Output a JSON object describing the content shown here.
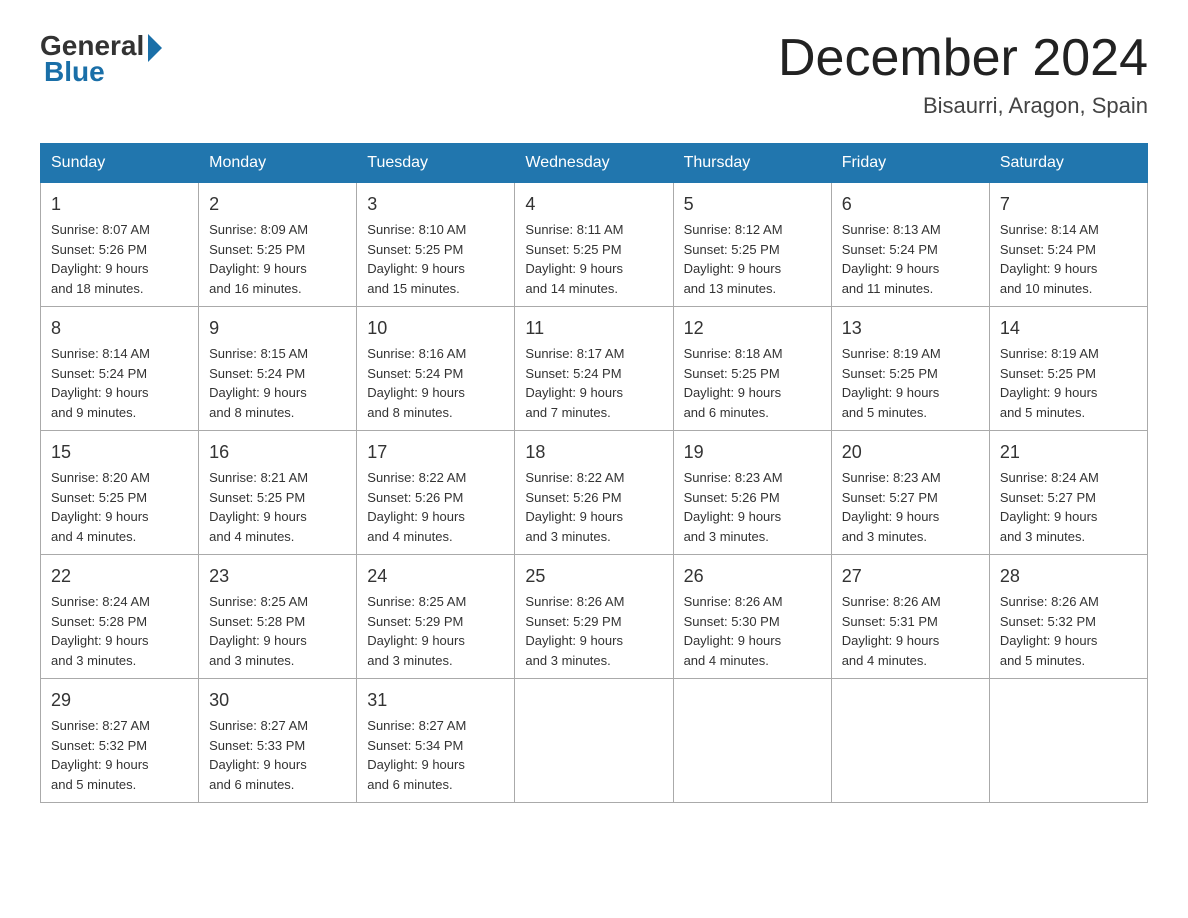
{
  "header": {
    "logo_general": "General",
    "logo_blue": "Blue",
    "main_title": "December 2024",
    "subtitle": "Bisaurri, Aragon, Spain"
  },
  "days_of_week": [
    "Sunday",
    "Monday",
    "Tuesday",
    "Wednesday",
    "Thursday",
    "Friday",
    "Saturday"
  ],
  "weeks": [
    [
      {
        "day": "1",
        "sunrise": "8:07 AM",
        "sunset": "5:26 PM",
        "daylight": "9 hours and 18 minutes."
      },
      {
        "day": "2",
        "sunrise": "8:09 AM",
        "sunset": "5:25 PM",
        "daylight": "9 hours and 16 minutes."
      },
      {
        "day": "3",
        "sunrise": "8:10 AM",
        "sunset": "5:25 PM",
        "daylight": "9 hours and 15 minutes."
      },
      {
        "day": "4",
        "sunrise": "8:11 AM",
        "sunset": "5:25 PM",
        "daylight": "9 hours and 14 minutes."
      },
      {
        "day": "5",
        "sunrise": "8:12 AM",
        "sunset": "5:25 PM",
        "daylight": "9 hours and 13 minutes."
      },
      {
        "day": "6",
        "sunrise": "8:13 AM",
        "sunset": "5:24 PM",
        "daylight": "9 hours and 11 minutes."
      },
      {
        "day": "7",
        "sunrise": "8:14 AM",
        "sunset": "5:24 PM",
        "daylight": "9 hours and 10 minutes."
      }
    ],
    [
      {
        "day": "8",
        "sunrise": "8:14 AM",
        "sunset": "5:24 PM",
        "daylight": "9 hours and 9 minutes."
      },
      {
        "day": "9",
        "sunrise": "8:15 AM",
        "sunset": "5:24 PM",
        "daylight": "9 hours and 8 minutes."
      },
      {
        "day": "10",
        "sunrise": "8:16 AM",
        "sunset": "5:24 PM",
        "daylight": "9 hours and 8 minutes."
      },
      {
        "day": "11",
        "sunrise": "8:17 AM",
        "sunset": "5:24 PM",
        "daylight": "9 hours and 7 minutes."
      },
      {
        "day": "12",
        "sunrise": "8:18 AM",
        "sunset": "5:25 PM",
        "daylight": "9 hours and 6 minutes."
      },
      {
        "day": "13",
        "sunrise": "8:19 AM",
        "sunset": "5:25 PM",
        "daylight": "9 hours and 5 minutes."
      },
      {
        "day": "14",
        "sunrise": "8:19 AM",
        "sunset": "5:25 PM",
        "daylight": "9 hours and 5 minutes."
      }
    ],
    [
      {
        "day": "15",
        "sunrise": "8:20 AM",
        "sunset": "5:25 PM",
        "daylight": "9 hours and 4 minutes."
      },
      {
        "day": "16",
        "sunrise": "8:21 AM",
        "sunset": "5:25 PM",
        "daylight": "9 hours and 4 minutes."
      },
      {
        "day": "17",
        "sunrise": "8:22 AM",
        "sunset": "5:26 PM",
        "daylight": "9 hours and 4 minutes."
      },
      {
        "day": "18",
        "sunrise": "8:22 AM",
        "sunset": "5:26 PM",
        "daylight": "9 hours and 3 minutes."
      },
      {
        "day": "19",
        "sunrise": "8:23 AM",
        "sunset": "5:26 PM",
        "daylight": "9 hours and 3 minutes."
      },
      {
        "day": "20",
        "sunrise": "8:23 AM",
        "sunset": "5:27 PM",
        "daylight": "9 hours and 3 minutes."
      },
      {
        "day": "21",
        "sunrise": "8:24 AM",
        "sunset": "5:27 PM",
        "daylight": "9 hours and 3 minutes."
      }
    ],
    [
      {
        "day": "22",
        "sunrise": "8:24 AM",
        "sunset": "5:28 PM",
        "daylight": "9 hours and 3 minutes."
      },
      {
        "day": "23",
        "sunrise": "8:25 AM",
        "sunset": "5:28 PM",
        "daylight": "9 hours and 3 minutes."
      },
      {
        "day": "24",
        "sunrise": "8:25 AM",
        "sunset": "5:29 PM",
        "daylight": "9 hours and 3 minutes."
      },
      {
        "day": "25",
        "sunrise": "8:26 AM",
        "sunset": "5:29 PM",
        "daylight": "9 hours and 3 minutes."
      },
      {
        "day": "26",
        "sunrise": "8:26 AM",
        "sunset": "5:30 PM",
        "daylight": "9 hours and 4 minutes."
      },
      {
        "day": "27",
        "sunrise": "8:26 AM",
        "sunset": "5:31 PM",
        "daylight": "9 hours and 4 minutes."
      },
      {
        "day": "28",
        "sunrise": "8:26 AM",
        "sunset": "5:32 PM",
        "daylight": "9 hours and 5 minutes."
      }
    ],
    [
      {
        "day": "29",
        "sunrise": "8:27 AM",
        "sunset": "5:32 PM",
        "daylight": "9 hours and 5 minutes."
      },
      {
        "day": "30",
        "sunrise": "8:27 AM",
        "sunset": "5:33 PM",
        "daylight": "9 hours and 6 minutes."
      },
      {
        "day": "31",
        "sunrise": "8:27 AM",
        "sunset": "5:34 PM",
        "daylight": "9 hours and 6 minutes."
      },
      null,
      null,
      null,
      null
    ]
  ],
  "labels": {
    "sunrise": "Sunrise:",
    "sunset": "Sunset:",
    "daylight": "Daylight:"
  }
}
